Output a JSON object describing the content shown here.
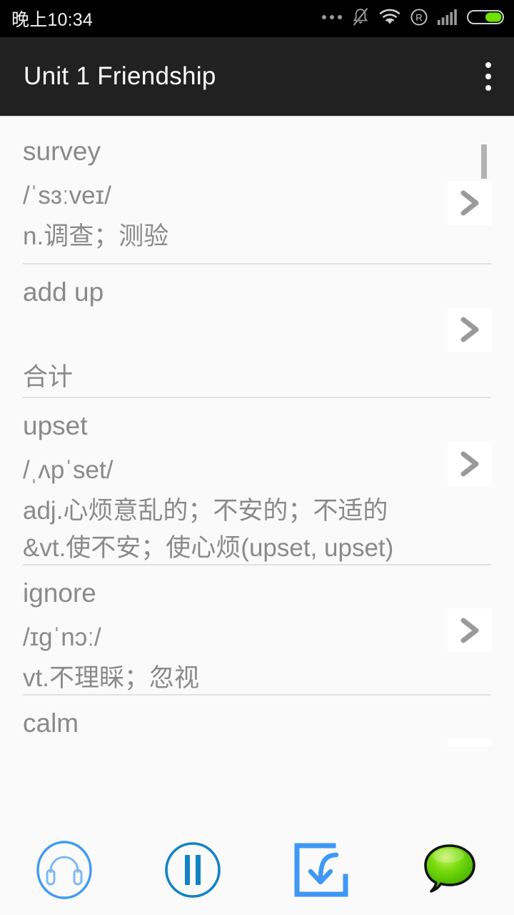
{
  "status_bar": {
    "time": "晚上10:34",
    "icons": [
      {
        "name": "more-dots-icon",
        "glyph": "..."
      },
      {
        "name": "silent-bell-icon",
        "glyph": "bell-slash"
      },
      {
        "name": "wifi-icon",
        "glyph": "wifi"
      },
      {
        "name": "roaming-icon",
        "glyph": "R"
      },
      {
        "name": "signal-bars-icon",
        "glyph": "signal"
      },
      {
        "name": "battery-icon",
        "glyph": "battery-full"
      }
    ],
    "background_color": "#000000"
  },
  "app_bar": {
    "title": "Unit 1 Friendship",
    "overflow_label": "更多",
    "background_color": "#212121",
    "title_color": "#ffffff"
  },
  "word_list": {
    "accent_color": "#8a8a8a",
    "divider_color": "#e2e2e2",
    "chevron_label": ">",
    "items": [
      {
        "word": "survey",
        "phonetic": "/ˈsɜːveɪ/",
        "meaning_lines": [
          "n.调查；测验"
        ]
      },
      {
        "word": "add up",
        "phonetic": "",
        "meaning_lines": [
          "合计"
        ]
      },
      {
        "word": "upset",
        "phonetic": "/ˌʌpˈset/",
        "meaning_lines": [
          "adj.心烦意乱的；不安的；不适的",
          "&vt.使不安；使心烦(upset, upset)"
        ]
      },
      {
        "word": "ignore",
        "phonetic": "/ɪgˈnɔː/",
        "meaning_lines": [
          "vt.不理睬；忽视"
        ]
      },
      {
        "word": "calm",
        "phonetic": "",
        "meaning_lines": []
      }
    ]
  },
  "bottom_toolbar": {
    "buttons": [
      {
        "name": "listen-button",
        "icon": "headphones-circle-icon",
        "color": "#3f9bf0"
      },
      {
        "name": "pause-button",
        "icon": "pause-circle-icon",
        "color": "#1183c4"
      },
      {
        "name": "import-button",
        "icon": "import-download-icon",
        "color": "#3f97f6"
      },
      {
        "name": "chat-button",
        "icon": "green-speech-balloon-icon",
        "color": "#5cc800"
      }
    ]
  }
}
